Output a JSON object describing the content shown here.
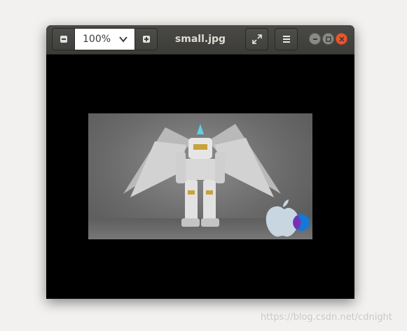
{
  "window": {
    "title": "small.jpg",
    "zoom_value": "100%"
  },
  "icons": {
    "zoom_out": "zoom-out-icon",
    "zoom_in": "zoom-in-icon",
    "dropdown": "chevron-down-icon",
    "fullscreen": "fullscreen-icon",
    "menu": "hamburger-menu-icon",
    "minimize": "minimize-icon",
    "maximize": "maximize-icon",
    "close": "close-icon"
  },
  "image": {
    "description_visible": "robot figure with wings on gray background",
    "overlay_logo": "apple-logo"
  },
  "watermark": "https://blog.csdn.net/cdnight",
  "colors": {
    "titlebar": "#3c3b37",
    "close_button": "#e9572f",
    "canvas": "#000000",
    "page_bg": "#f2f1f0"
  }
}
